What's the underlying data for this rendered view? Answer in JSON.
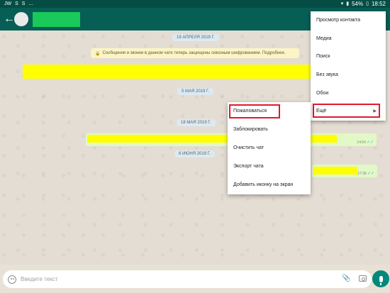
{
  "status_bar": {
    "left_icons": [
      "JW",
      "S",
      "S",
      "..."
    ],
    "battery_percent": "54%",
    "clock": "18:52"
  },
  "chat_header": {
    "back_icon": "arrow-left-icon"
  },
  "chat": {
    "dates": [
      "19 АПРЕЛЯ 2019 Г.",
      "5 МАЯ 2019 Г.",
      "18 МАЯ 2019 Г.",
      "6 ИЮНЯ 2019 Г."
    ],
    "encryption_notice": "Сообщения и звонки в данном чате теперь защищены сквозным шифрованием. Подробнее.",
    "message_times": [
      "14:54",
      "17:36"
    ]
  },
  "overflow_menu": {
    "items": [
      "Просмотр контакта",
      "Медиа",
      "Поиск",
      "Без звука",
      "Обои",
      "Ещё"
    ]
  },
  "submenu": {
    "items": [
      "Пожаловаться",
      "Заблокировать",
      "Очистить чат",
      "Экспорт чата",
      "Добавить иконку на экран"
    ]
  },
  "composer": {
    "placeholder": "Введите текст"
  },
  "colors": {
    "header": "#075e54",
    "accent": "#00897b",
    "highlight": "#e1192d",
    "redaction": "#ffff00"
  }
}
